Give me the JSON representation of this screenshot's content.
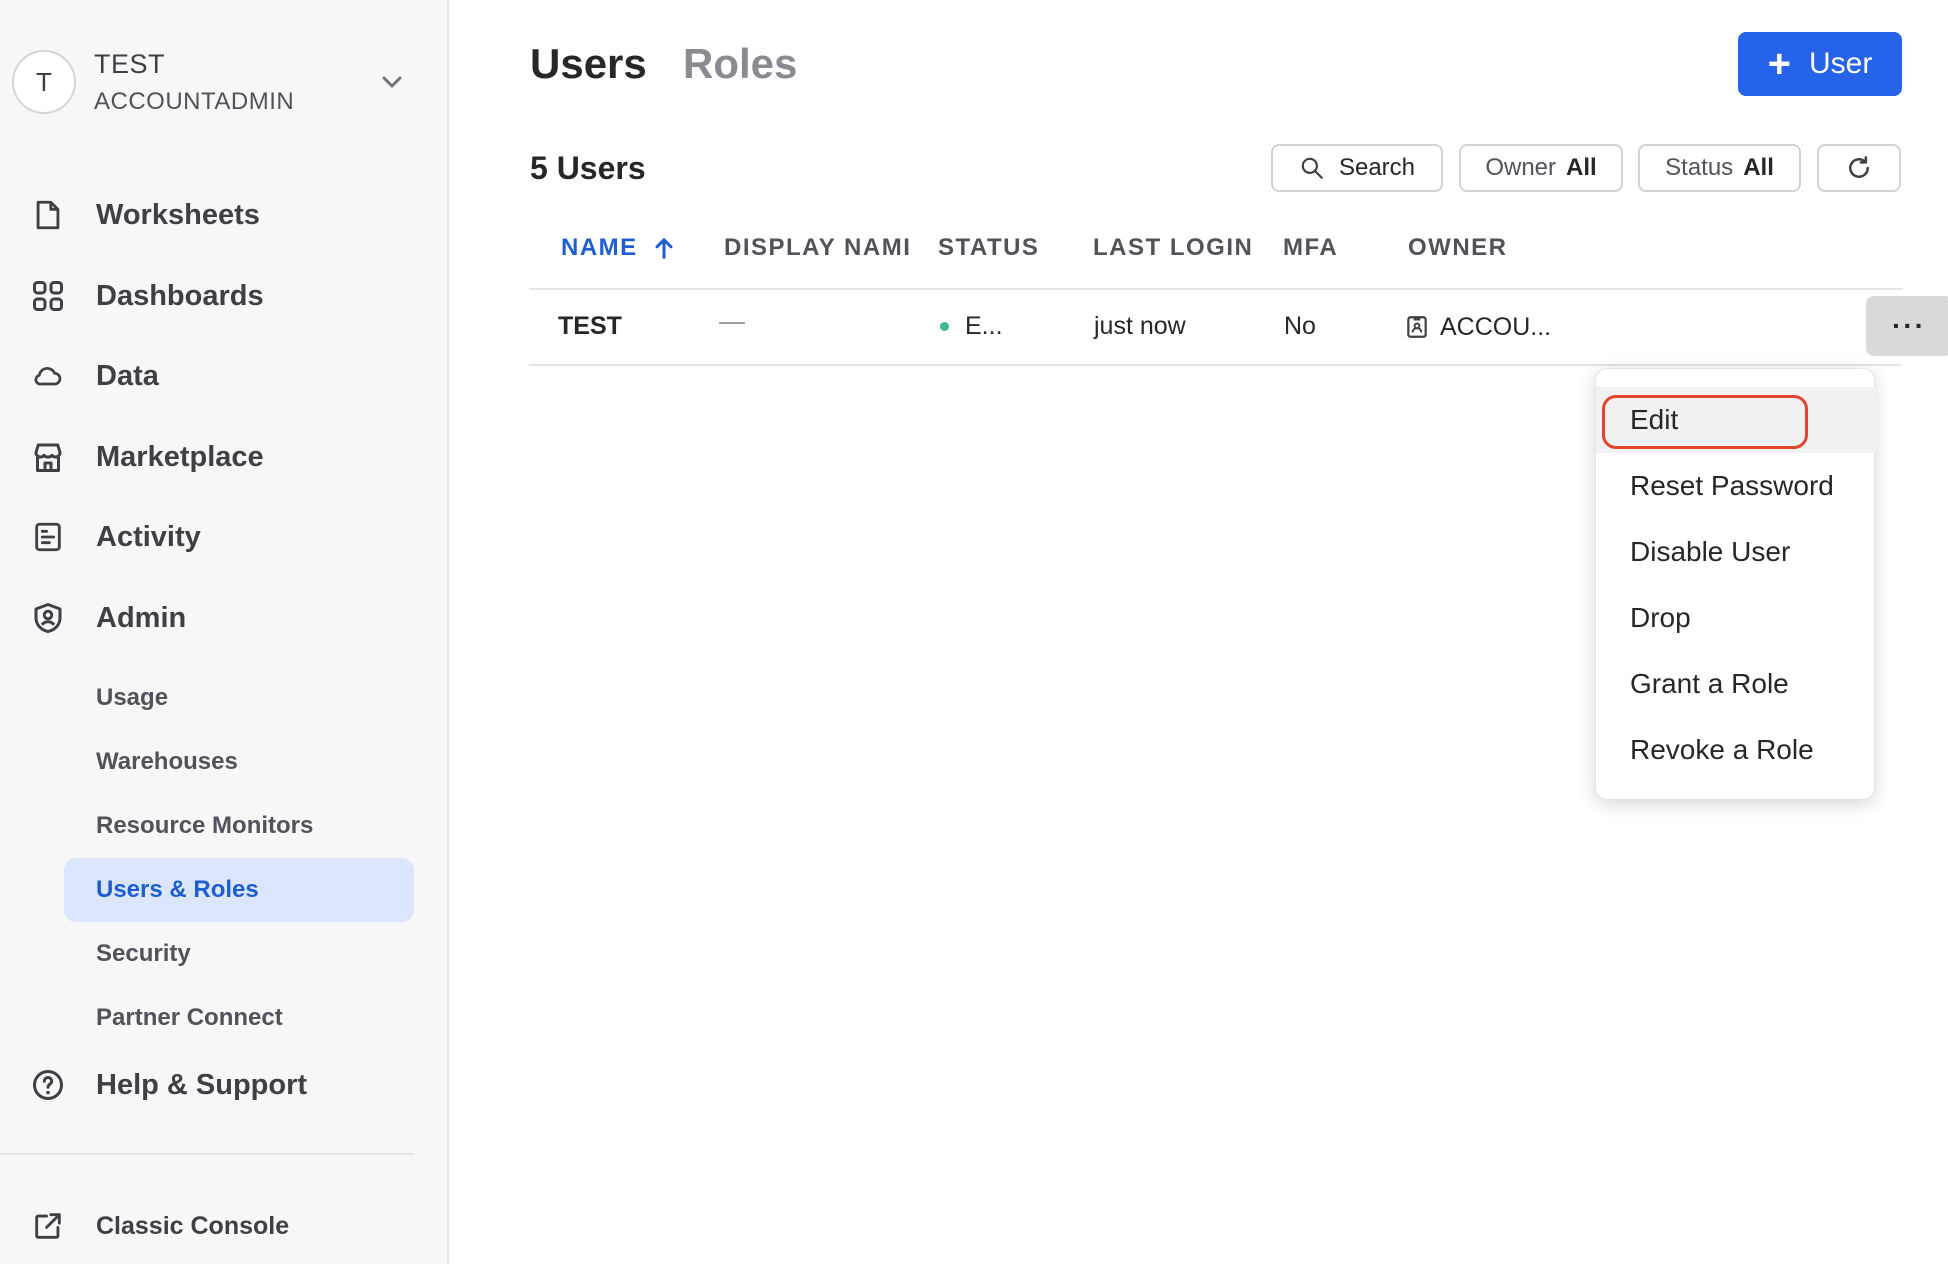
{
  "account": {
    "initial": "T",
    "name": "TEST",
    "role": "ACCOUNTADMIN"
  },
  "sidebar": {
    "items": [
      {
        "label": "Worksheets",
        "icon": "file-icon"
      },
      {
        "label": "Dashboards",
        "icon": "grid-icon"
      },
      {
        "label": "Data",
        "icon": "cloud-icon"
      },
      {
        "label": "Marketplace",
        "icon": "store-icon"
      },
      {
        "label": "Activity",
        "icon": "activity-icon"
      },
      {
        "label": "Admin",
        "icon": "shield-icon"
      }
    ],
    "admin_items": [
      {
        "label": "Usage"
      },
      {
        "label": "Warehouses"
      },
      {
        "label": "Resource Monitors"
      },
      {
        "label": "Users & Roles",
        "active": true
      },
      {
        "label": "Security"
      },
      {
        "label": "Partner Connect"
      }
    ],
    "help": {
      "label": "Help & Support",
      "icon": "help-icon"
    },
    "classic": {
      "label": "Classic Console",
      "icon": "external-link-icon"
    }
  },
  "header": {
    "tabs": [
      {
        "label": "Users",
        "active": true
      },
      {
        "label": "Roles",
        "active": false
      }
    ],
    "add_button": {
      "plus": "+",
      "label": "User"
    }
  },
  "toolbar": {
    "count_label": "5 Users",
    "search_label": "Search",
    "owner_filter": {
      "label": "Owner",
      "value": "All"
    },
    "status_filter": {
      "label": "Status",
      "value": "All"
    }
  },
  "table": {
    "columns": [
      "NAME",
      "DISPLAY NAMI",
      "STATUS",
      "LAST LOGIN",
      "MFA",
      "OWNER"
    ],
    "rows": [
      {
        "name": "TEST",
        "display_name": "—",
        "status": "E...",
        "last_login": "just now",
        "mfa": "No",
        "owner": "ACCOU..."
      }
    ],
    "more_label": "···"
  },
  "context_menu": {
    "items": [
      "Edit",
      "Reset Password",
      "Disable User",
      "Drop",
      "Grant a Role",
      "Revoke a Role"
    ]
  },
  "colors": {
    "accent": "#2563eb",
    "active_nav_bg": "#dbe6fc",
    "status_enabled": "#3dbb8a",
    "highlight": "#e2452b"
  }
}
